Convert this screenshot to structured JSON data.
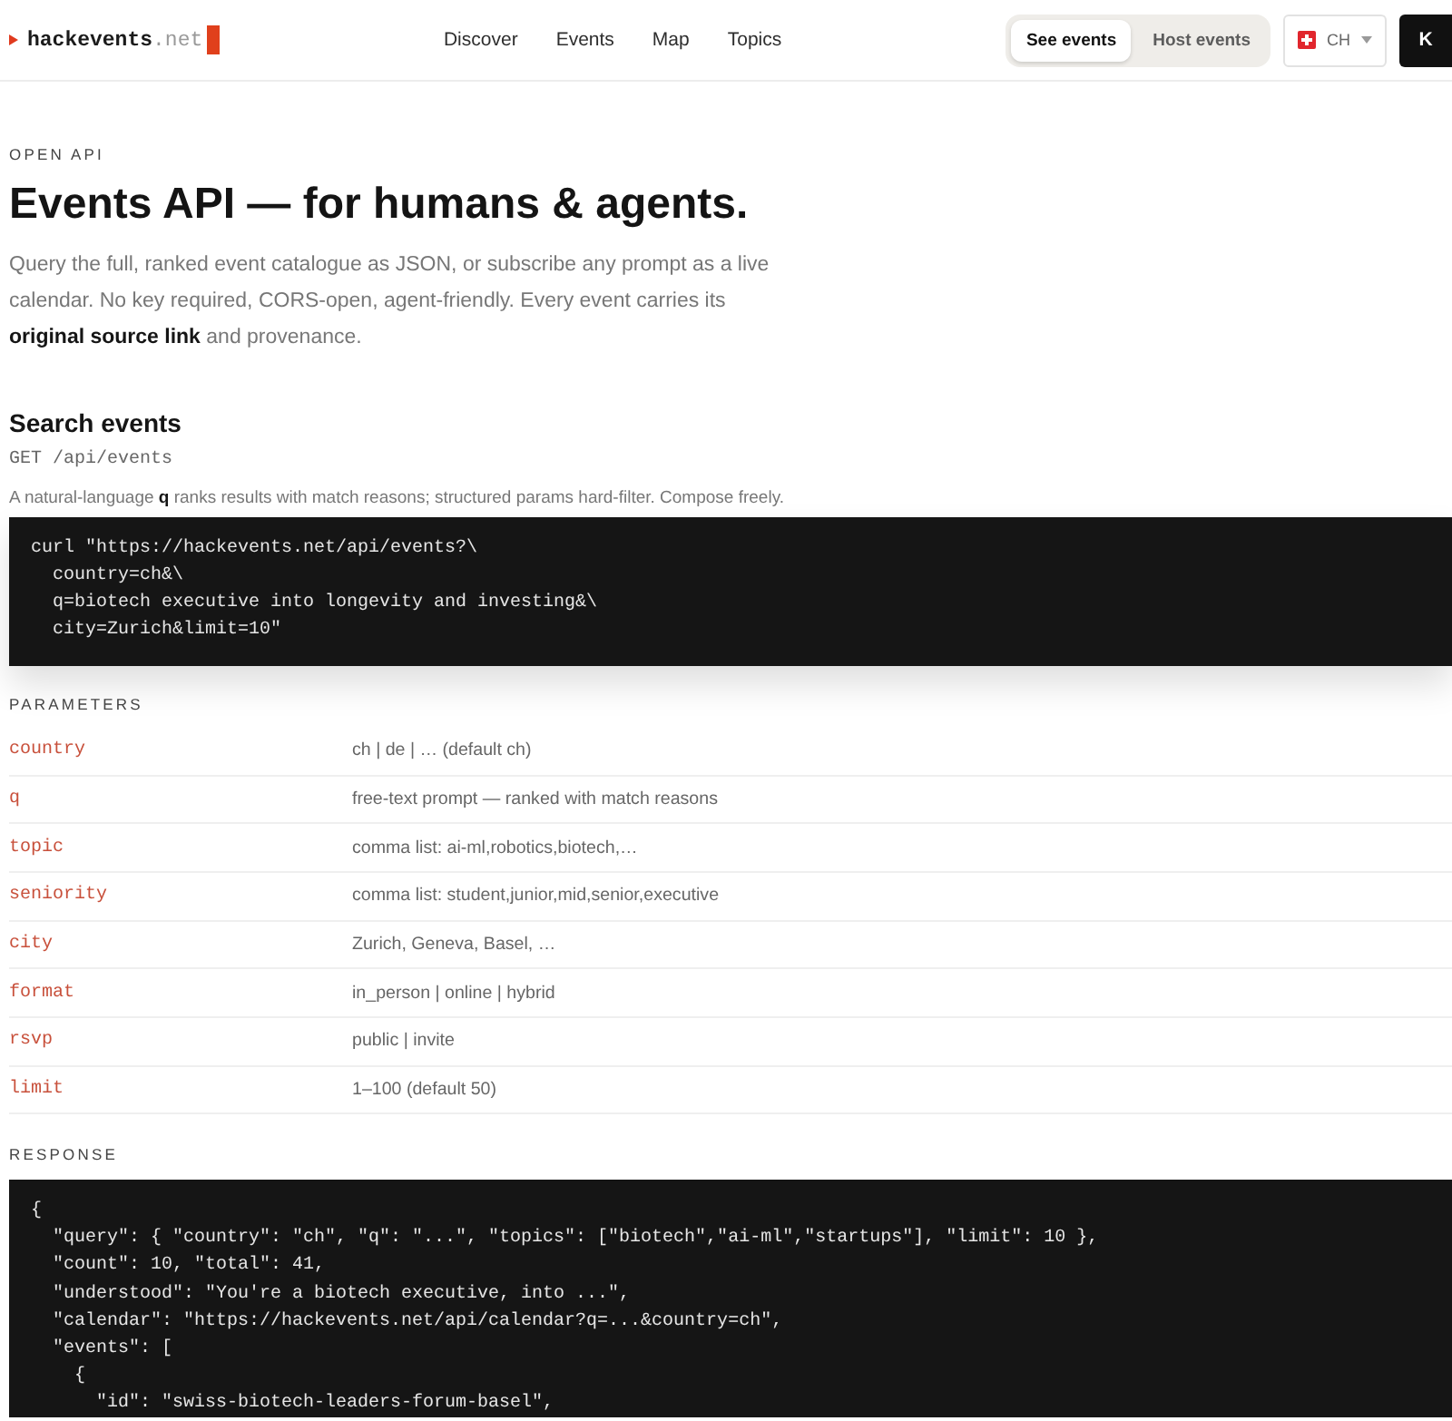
{
  "header": {
    "logo": {
      "name": "hackevents",
      "suffix": ".net"
    },
    "nav": [
      {
        "label": "Discover"
      },
      {
        "label": "Events"
      },
      {
        "label": "Map"
      },
      {
        "label": "Topics"
      }
    ],
    "view_toggle": [
      {
        "label": "See events",
        "selected": true
      },
      {
        "label": "Host events",
        "selected": false
      }
    ],
    "country": {
      "code": "CH"
    },
    "account": {
      "initial": "K"
    }
  },
  "intro": {
    "eyebrow": "OPEN API",
    "title": "Events API — for humans & agents.",
    "description": "Query the full, ranked event catalogue as JSON, or subscribe any prompt as a live calendar. No key required, CORS-open, agent-friendly. Every event carries its **original source link** and provenance."
  },
  "search": {
    "heading": "Search events",
    "endpoint": "GET /api/events",
    "description": "A natural-language **q** ranks results with match reasons; structured params hard-filter. Compose freely.",
    "request_code": [
      "curl \"https://hackevents.net/api/events?\\",
      "  country=ch&\\",
      "  q=biotech executive into longevity and investing&\\",
      "  city=Zurich&limit=10\""
    ]
  },
  "parameters": {
    "heading": "PARAMETERS",
    "rows": [
      {
        "name": "country",
        "description": "ch | de | … (default ch)"
      },
      {
        "name": "q",
        "description": "free-text prompt — ranked with match reasons"
      },
      {
        "name": "topic",
        "description": "comma list: ai-ml,robotics,biotech,…"
      },
      {
        "name": "seniority",
        "description": "comma list: student,junior,mid,senior,executive"
      },
      {
        "name": "city",
        "description": "Zurich, Geneva, Basel, …"
      },
      {
        "name": "format",
        "description": "in_person | online | hybrid"
      },
      {
        "name": "rsvp",
        "description": "public | invite"
      },
      {
        "name": "limit",
        "description": "1–100 (default 50)"
      }
    ]
  },
  "response": {
    "heading": "RESPONSE",
    "code": [
      "{",
      "  \"query\": { \"country\": \"ch\", \"q\": \"...\", \"topics\": [\"biotech\",\"ai-ml\",\"startups\"], \"limit\": 10 },",
      "  \"count\": 10, \"total\": 41,",
      "  \"understood\": \"You're a biotech executive, into ...\",",
      "  \"calendar\": \"https://hackevents.net/api/calendar?q=...&country=ch\",",
      "  \"events\": [",
      "    {",
      "      \"id\": \"swiss-biotech-leaders-forum-basel\","
    ]
  }
}
